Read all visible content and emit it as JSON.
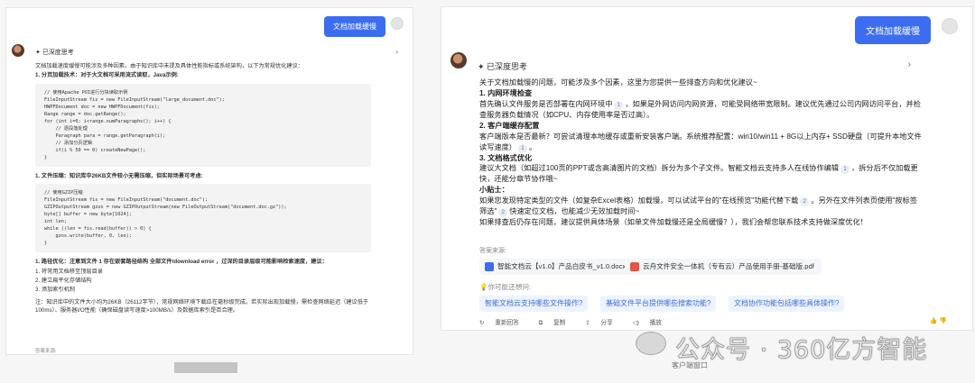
{
  "left": {
    "question_button": "文档加载缓慢",
    "deep_thinking_label": "已深度思考",
    "chevron": "›",
    "intro": "文档加载速度缓慢可能涉及多种因素。由于知识库中未提及具体性能指标或系统架构，以下为常规优化建议：",
    "s1_title": "1. 分页加载技术：对于大文档可采用流式读取，Java示例:",
    "code1": "// 使用Apache POI进行分块读取示例\nFileInputStream fis = new FileInputStream(\"large_document.doc\");\nHWPFDocument doc = new HWPFDocument(fis);\nRange range = doc.getRange();\nfor (int i=0; i<range.numParagraphs(); i++) {\n    // 逐段落处理\n    Paragraph para = range.getParagraph(i);\n    // 添加分页逻辑\n    if(i % 50 == 0) createNewPage();\n}",
    "s2_title": "1. 文件压缩：知识库中26KB文件较小无需压缩，但实际场景可考虑:",
    "code2": "// 使用GZIP压缩\nFileInputStream fis = new FileInputStream(\"document.doc\");\nGZIPOutputStream gzos = new GZIPOutputStream(new FileOutputStream(\"document.doc.gz\"));\nbyte[] buffer = new byte[1024];\nint len;\nwhile ((len = fis.read(buffer)) > 0) {\n    gzos.write(buffer, 0, len);\n}",
    "s3_title": "1. 路径优化：注意到文件 1 存在嵌套路径结构 全部文件/download error ，过深的目录层级可能影响检索速度，建议：",
    "s3_items": [
      "1. 将常用文档移至顶层目录",
      "2. 建立扁平化存储结构",
      "3. 添加索引机制"
    ],
    "note": "注：知识库中的文件大小均为26KB（26112字节），常规网络环境下载应在毫秒级完成。若实际出现加载慢，需检查网络延迟（建议低于100ms）、服务器I/O性能（确保磁盘读写速度>100MB/s）及数据库索引是否合理。",
    "source_label": "答案来源:"
  },
  "right": {
    "question_button": "文档加载缓慢",
    "deep_thinking_label": "已深度思考",
    "chevron": "›",
    "intro": "关于文档加载慢的问题，可能涉及多个因素，这里为您提供一些排查方向和优化建议~",
    "h1": "1. 内网环境检查",
    "p1a": "首先确认文件服务是否部署在内网环境中",
    "cite1": "1",
    "p1b": "，如果是外网访问内网资源，可能受网络带宽限制。建议优先通过公司内网访问平台，并检查服务器负载情况（如CPU、内存使用率是否过高）。",
    "h2": "2. 客户端缓存配置",
    "p2a": "客户端版本是否最新？可尝试清理本地缓存或重新安装客户端。系统推荐配置：win10/win11 + 8G以上内存+ SSD硬盘（可提升本地文件读写速度）",
    "cite2": "1",
    "p2b": "。",
    "h3": "3. 文档格式优化",
    "p3a": "建议大文档（如超过100页的PPT或含高清图片的文档）拆分为多个子文件。智能文档云支持多人在线协作编辑",
    "cite3": "1",
    "p3b": "，拆分后不仅加载更快，还能分章节协作哦~",
    "tip_title": "小贴士：",
    "tip_a": "如果您发现特定类型的文件（如复杂Excel表格）加载慢，可以试试平台的\"在线预览\"功能代替下载",
    "cite4": "2",
    "tip_b": "。另外在文件列表页使用\"按标签筛选\"",
    "cite5": "2",
    "tip_c": "快速定位文档，也能减少无效加载时间~",
    "final": "如果排查后仍存在问题，建议提供具体场景（如单文件加载慢还是全局缓慢？），我们会帮您联系技术支持做深度优化！",
    "source_label": "答案来源:",
    "doc1": "智能文档云【v1.0】产品白皮书_v1.0.docx",
    "doc2": "云舟文件安全一体机（专有云）产品使用手册-基础版.pdf",
    "maybe_ask": "你可能还想问:",
    "suggestions": [
      "智能文档云支持哪些文件操作?",
      "基础文件平台提供哪些搜索功能?",
      "文档协作功能包括哪些具体操作?"
    ],
    "actions": [
      "重新回答",
      "复制",
      "分享",
      "播放"
    ]
  },
  "watermark": "公众号 · 360亿方智能",
  "caption_right": "客户端窗口",
  "colors": {
    "accent": "#3c6df0",
    "link": "#3a6fd8"
  }
}
